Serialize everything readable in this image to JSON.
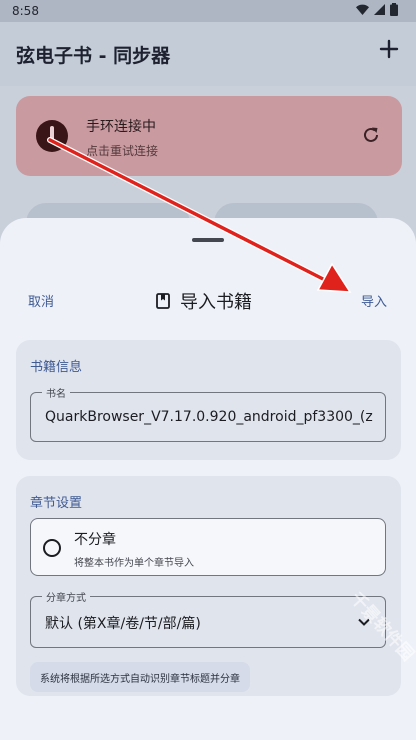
{
  "status_bar": {
    "time": "8:58"
  },
  "app_bar": {
    "title": "弦电子书 - 同步器",
    "add_icon": "plus-icon"
  },
  "connection_card": {
    "title": "手环连接中",
    "subtitle": "点击重试连接",
    "icon": "disconnected-icon",
    "refresh_icon": "refresh-icon"
  },
  "sheet": {
    "cancel_label": "取消",
    "title": "导入书籍",
    "title_icon": "book-icon",
    "import_label": "导入",
    "book_info": {
      "header": "书籍信息",
      "name_legend": "书名",
      "name_value": "QuarkBrowser_V7.17.0.920_android_pf3300_(z"
    },
    "chapter_settings": {
      "header": "章节设置",
      "option_title": "不分章",
      "option_desc": "将整本书作为单个章节导入",
      "mode_legend": "分章方式",
      "mode_value": "默认 (第X章/卷/节/部/篇)",
      "hint": "系统将根据所选方式自动识别章节标题并分章"
    }
  },
  "watermark": "千景软件园",
  "colors": {
    "accent": "#3f5a93",
    "arrow": "#e0221c",
    "sheet_bg": "#eef1f8",
    "section_bg": "#e0e4ed"
  }
}
